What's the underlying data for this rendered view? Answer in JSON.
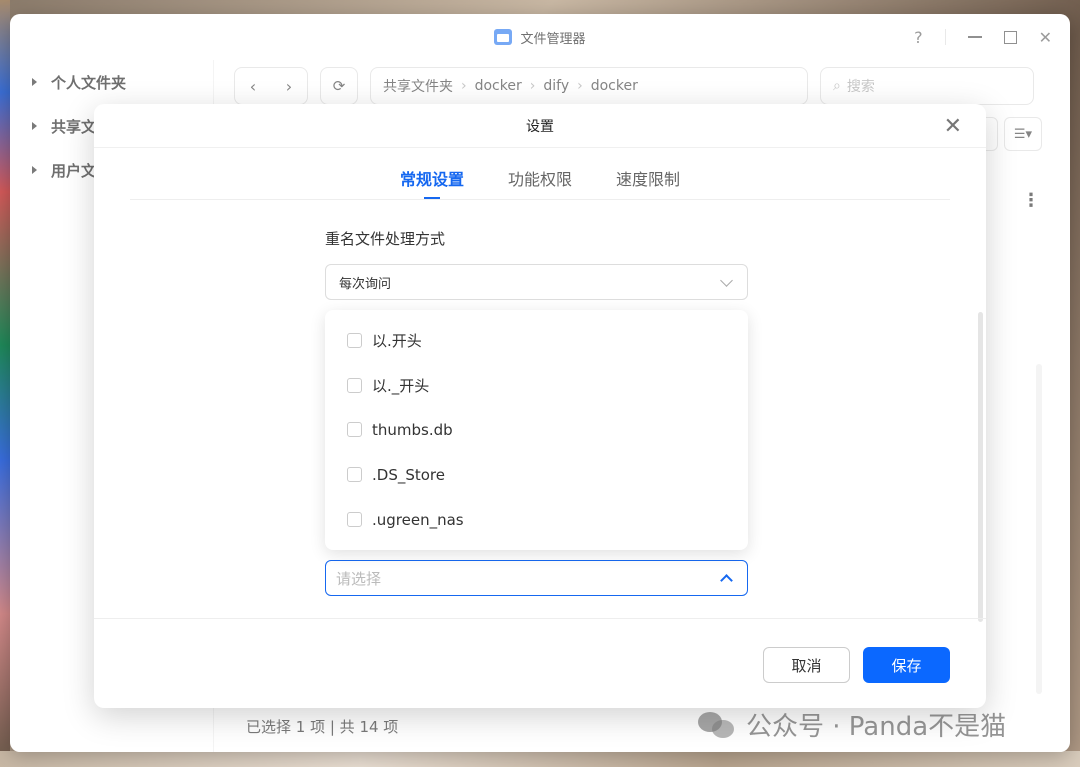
{
  "window": {
    "title": "文件管理器",
    "help_icon": "?",
    "sidebar": [
      {
        "label": "个人文件夹"
      },
      {
        "label": "共享文件夹"
      },
      {
        "label": "用户文件夹"
      }
    ],
    "breadcrumb": [
      "共享文件夹",
      "docker",
      "dify",
      "docker"
    ],
    "search_placeholder": "搜索",
    "status_text": "已选择 1 项 | 共 14 项"
  },
  "modal": {
    "title": "设置",
    "tabs": [
      {
        "label": "常规设置",
        "active": true
      },
      {
        "label": "功能权限",
        "active": false
      },
      {
        "label": "速度限制",
        "active": false
      }
    ],
    "rename_label": "重名文件处理方式",
    "rename_value": "每次询问",
    "hide_options": [
      {
        "label": "以.开头",
        "checked": false
      },
      {
        "label": "以._开头",
        "checked": false
      },
      {
        "label": "thumbs.db",
        "checked": false
      },
      {
        "label": ".DS_Store",
        "checked": false
      },
      {
        "label": ".ugreen_nas",
        "checked": false
      }
    ],
    "hide_select_placeholder": "请选择",
    "cancel_label": "取消",
    "save_label": "保存"
  },
  "watermark": "公众号 · Panda不是猫",
  "colors": {
    "accent": "#1668f0",
    "save_button": "#0b68ff"
  }
}
